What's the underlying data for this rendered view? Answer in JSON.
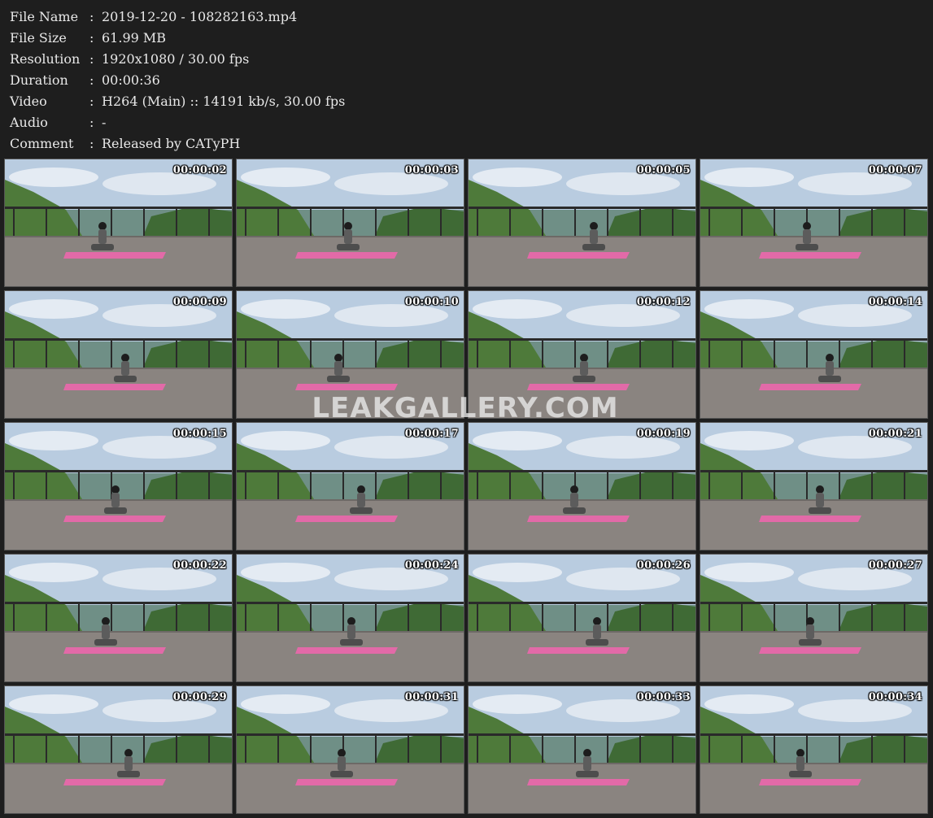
{
  "info": [
    {
      "label": "File Name",
      "colon": ":",
      "value": "2019-12-20 - 108282163.mp4"
    },
    {
      "label": "File Size",
      "colon": ":",
      "value": "61.99 MB"
    },
    {
      "label": "Resolution",
      "colon": ":",
      "value": "1920x1080 / 30.00 fps"
    },
    {
      "label": "Duration",
      "colon": ":",
      "value": "00:00:36"
    },
    {
      "label": "Video",
      "colon": ":",
      "value": "H264 (Main) :: 14191 kb/s, 30.00 fps"
    },
    {
      "label": "Audio",
      "colon": ":",
      "value": "-"
    },
    {
      "label": "Comment",
      "colon": ":",
      "value": "Released by CATyPH"
    }
  ],
  "thumbnails": [
    {
      "timestamp": "00:00:02"
    },
    {
      "timestamp": "00:00:03"
    },
    {
      "timestamp": "00:00:05"
    },
    {
      "timestamp": "00:00:07"
    },
    {
      "timestamp": "00:00:09"
    },
    {
      "timestamp": "00:00:10"
    },
    {
      "timestamp": "00:00:12"
    },
    {
      "timestamp": "00:00:14"
    },
    {
      "timestamp": "00:00:15"
    },
    {
      "timestamp": "00:00:17"
    },
    {
      "timestamp": "00:00:19"
    },
    {
      "timestamp": "00:00:21"
    },
    {
      "timestamp": "00:00:22"
    },
    {
      "timestamp": "00:00:24"
    },
    {
      "timestamp": "00:00:26"
    },
    {
      "timestamp": "00:00:27"
    },
    {
      "timestamp": "00:00:29"
    },
    {
      "timestamp": "00:00:31"
    },
    {
      "timestamp": "00:00:33"
    },
    {
      "timestamp": "00:00:34"
    }
  ],
  "watermark": "LEAKGALLERY.COM",
  "colors": {
    "background": "#1e1e1e",
    "text": "#e8e8e8",
    "sky": "#b9cce0",
    "hills": "#4e7a3a",
    "railing": "#2a2a2a",
    "deck": "#8a8480",
    "mat": "#e26aa8"
  }
}
